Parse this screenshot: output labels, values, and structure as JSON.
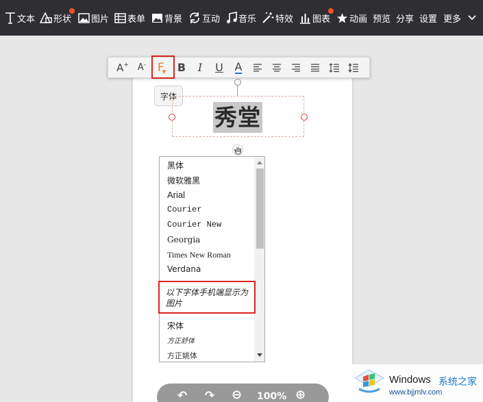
{
  "toolbar": {
    "items": [
      {
        "label": "文本",
        "icon": "text-icon"
      },
      {
        "label": "形状",
        "icon": "shape-icon",
        "badge": true
      },
      {
        "label": "图片",
        "icon": "image-icon"
      },
      {
        "label": "表单",
        "icon": "form-icon"
      },
      {
        "label": "背景",
        "icon": "background-icon"
      },
      {
        "label": "互动",
        "icon": "interact-icon"
      },
      {
        "label": "音乐",
        "icon": "music-icon"
      },
      {
        "label": "特效",
        "icon": "effect-icon"
      },
      {
        "label": "图表",
        "icon": "chart-icon",
        "badge": true
      },
      {
        "label": "动画",
        "icon": "animation-icon"
      },
      {
        "label": "预览"
      },
      {
        "label": "分享"
      },
      {
        "label": "设置"
      },
      {
        "label": "更多",
        "icon": "chevron-down-icon"
      }
    ],
    "badge_color": "#f2542d"
  },
  "format_bar": {
    "increase_font": "A",
    "decrease_font": "A",
    "font_family": "F",
    "bold": "B",
    "italic": "I",
    "underline": "U",
    "color": "A",
    "tooltip": "字体"
  },
  "canvas": {
    "text": "秀堂"
  },
  "font_list": {
    "items": [
      "黑体",
      "微软雅黑",
      "Arial",
      "Courier",
      "Courier New",
      "Georgia",
      "Times New Roman",
      "Verdana"
    ],
    "note_line1": "以下字体手机端显示为",
    "note_line2": "图片",
    "image_fonts": [
      "宋体",
      "方正舒体",
      "方正姚体"
    ]
  },
  "zoom": {
    "undo": "↶",
    "redo": "↷",
    "zoom_out": "⊖",
    "level": "100%",
    "zoom_in": "⊕"
  },
  "watermark": {
    "title": "Windows",
    "title2": "系统之家",
    "url": "www.bjjmlv.com"
  },
  "colors": {
    "highlight": "#d9251c",
    "toolbar_bg": "#2f2f33",
    "accent": "#f07a2a"
  }
}
